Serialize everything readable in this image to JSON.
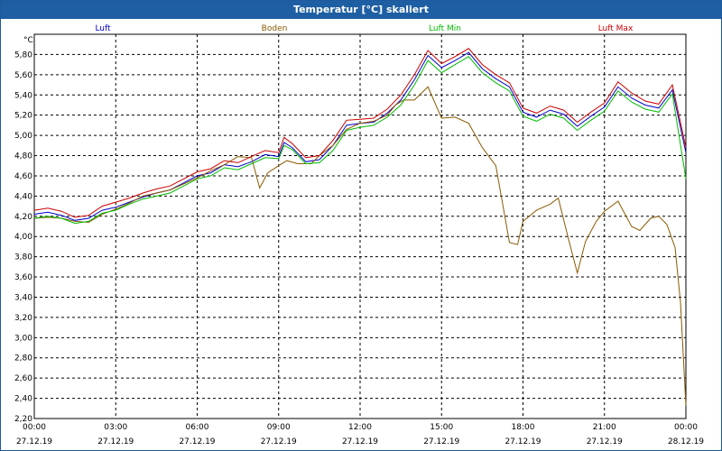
{
  "window": {
    "title": "Temperatur [°C] skaliert"
  },
  "chart_data": {
    "type": "line",
    "title": "Temperatur [°C] skaliert",
    "ylabel": "°C",
    "xlabel": "",
    "ylim": [
      2.2,
      6.0
    ],
    "yticks": [
      2.2,
      2.4,
      2.6,
      2.8,
      3.0,
      3.2,
      3.4,
      3.6,
      3.8,
      4.0,
      4.2,
      4.4,
      4.6,
      4.8,
      5.0,
      5.2,
      5.4,
      5.6,
      5.8
    ],
    "xlim": [
      0,
      24
    ],
    "xticks": [
      {
        "x": 0,
        "time": "00:00",
        "date": "27.12.19"
      },
      {
        "x": 3,
        "time": "03:00",
        "date": "27.12.19"
      },
      {
        "x": 6,
        "time": "06:00",
        "date": "27.12.19"
      },
      {
        "x": 9,
        "time": "09:00",
        "date": "27.12.19"
      },
      {
        "x": 12,
        "time": "12:00",
        "date": "27.12.19"
      },
      {
        "x": 15,
        "time": "15:00",
        "date": "27.12.19"
      },
      {
        "x": 18,
        "time": "18:00",
        "date": "27.12.19"
      },
      {
        "x": 21,
        "time": "21:00",
        "date": "27.12.19"
      },
      {
        "x": 24,
        "time": "00:00",
        "date": "28.12.19"
      }
    ],
    "grid": true,
    "legend_position": "top",
    "series": [
      {
        "name": "Luft",
        "color": "#0000cc",
        "points": [
          [
            0,
            4.22
          ],
          [
            0.5,
            4.24
          ],
          [
            1,
            4.21
          ],
          [
            1.5,
            4.16
          ],
          [
            2,
            4.18
          ],
          [
            2.5,
            4.26
          ],
          [
            3,
            4.29
          ],
          [
            3.5,
            4.34
          ],
          [
            4,
            4.39
          ],
          [
            4.5,
            4.43
          ],
          [
            5,
            4.46
          ],
          [
            5.5,
            4.53
          ],
          [
            6,
            4.6
          ],
          [
            6.5,
            4.63
          ],
          [
            7,
            4.71
          ],
          [
            7.5,
            4.69
          ],
          [
            8,
            4.74
          ],
          [
            8.5,
            4.81
          ],
          [
            9,
            4.79
          ],
          [
            9.2,
            4.93
          ],
          [
            9.5,
            4.88
          ],
          [
            10,
            4.74
          ],
          [
            10.5,
            4.76
          ],
          [
            11,
            4.9
          ],
          [
            11.5,
            5.1
          ],
          [
            12,
            5.12
          ],
          [
            12.5,
            5.13
          ],
          [
            13,
            5.22
          ],
          [
            13.5,
            5.35
          ],
          [
            14,
            5.55
          ],
          [
            14.5,
            5.79
          ],
          [
            15,
            5.67
          ],
          [
            15.5,
            5.74
          ],
          [
            16,
            5.82
          ],
          [
            16.5,
            5.66
          ],
          [
            17,
            5.56
          ],
          [
            17.5,
            5.48
          ],
          [
            18,
            5.23
          ],
          [
            18.5,
            5.18
          ],
          [
            19,
            5.25
          ],
          [
            19.5,
            5.21
          ],
          [
            20,
            5.09
          ],
          [
            20.5,
            5.19
          ],
          [
            21,
            5.28
          ],
          [
            21.5,
            5.48
          ],
          [
            22,
            5.37
          ],
          [
            22.5,
            5.3
          ],
          [
            23,
            5.27
          ],
          [
            23.5,
            5.45
          ],
          [
            24,
            4.83
          ]
        ]
      },
      {
        "name": "Boden",
        "color": "#8b5a00",
        "points": [
          [
            0,
            4.18
          ],
          [
            0.5,
            4.19
          ],
          [
            1,
            4.18
          ],
          [
            1.5,
            4.15
          ],
          [
            2,
            4.14
          ],
          [
            2.5,
            4.22
          ],
          [
            3,
            4.27
          ],
          [
            3.5,
            4.33
          ],
          [
            4,
            4.4
          ],
          [
            4.5,
            4.43
          ],
          [
            5,
            4.46
          ],
          [
            5.5,
            4.52
          ],
          [
            6,
            4.58
          ],
          [
            6.5,
            4.65
          ],
          [
            7,
            4.71
          ],
          [
            7.5,
            4.79
          ],
          [
            8,
            4.78
          ],
          [
            8.3,
            4.48
          ],
          [
            8.6,
            4.63
          ],
          [
            9,
            4.7
          ],
          [
            9.3,
            4.75
          ],
          [
            9.7,
            4.72
          ],
          [
            10.2,
            4.72
          ],
          [
            10.5,
            4.8
          ],
          [
            11,
            4.9
          ],
          [
            11.5,
            5.06
          ],
          [
            12,
            5.12
          ],
          [
            12.5,
            5.14
          ],
          [
            13,
            5.2
          ],
          [
            13.3,
            5.3
          ],
          [
            13.6,
            5.35
          ],
          [
            14,
            5.35
          ],
          [
            14.5,
            5.48
          ],
          [
            15,
            5.17
          ],
          [
            15.5,
            5.18
          ],
          [
            16,
            5.12
          ],
          [
            16.5,
            4.88
          ],
          [
            17,
            4.7
          ],
          [
            17.3,
            4.25
          ],
          [
            17.5,
            3.94
          ],
          [
            17.8,
            3.92
          ],
          [
            18,
            4.15
          ],
          [
            18.5,
            4.26
          ],
          [
            19,
            4.32
          ],
          [
            19.3,
            4.38
          ],
          [
            19.7,
            3.95
          ],
          [
            20,
            3.64
          ],
          [
            20.3,
            3.95
          ],
          [
            20.7,
            4.15
          ],
          [
            21,
            4.25
          ],
          [
            21.5,
            4.35
          ],
          [
            22,
            4.1
          ],
          [
            22.3,
            4.06
          ],
          [
            22.7,
            4.18
          ],
          [
            23,
            4.2
          ],
          [
            23.3,
            4.12
          ],
          [
            23.6,
            3.89
          ],
          [
            23.8,
            3.35
          ],
          [
            24,
            2.33
          ]
        ]
      },
      {
        "name": "Luft Min",
        "color": "#00bb00",
        "points": [
          [
            0,
            4.18
          ],
          [
            0.5,
            4.2
          ],
          [
            1,
            4.18
          ],
          [
            1.5,
            4.13
          ],
          [
            2,
            4.15
          ],
          [
            2.5,
            4.23
          ],
          [
            3,
            4.26
          ],
          [
            3.5,
            4.32
          ],
          [
            4,
            4.37
          ],
          [
            4.5,
            4.4
          ],
          [
            5,
            4.43
          ],
          [
            5.5,
            4.5
          ],
          [
            6,
            4.57
          ],
          [
            6.5,
            4.6
          ],
          [
            7,
            4.68
          ],
          [
            7.5,
            4.66
          ],
          [
            8,
            4.72
          ],
          [
            8.5,
            4.78
          ],
          [
            9,
            4.77
          ],
          [
            9.2,
            4.9
          ],
          [
            9.5,
            4.86
          ],
          [
            10,
            4.72
          ],
          [
            10.5,
            4.73
          ],
          [
            11,
            4.85
          ],
          [
            11.5,
            5.05
          ],
          [
            12,
            5.08
          ],
          [
            12.5,
            5.1
          ],
          [
            13,
            5.18
          ],
          [
            13.5,
            5.3
          ],
          [
            14,
            5.5
          ],
          [
            14.5,
            5.74
          ],
          [
            15,
            5.62
          ],
          [
            15.5,
            5.7
          ],
          [
            16,
            5.78
          ],
          [
            16.5,
            5.62
          ],
          [
            17,
            5.52
          ],
          [
            17.5,
            5.44
          ],
          [
            18,
            5.19
          ],
          [
            18.5,
            5.14
          ],
          [
            19,
            5.21
          ],
          [
            19.5,
            5.17
          ],
          [
            20,
            5.05
          ],
          [
            20.5,
            5.15
          ],
          [
            21,
            5.24
          ],
          [
            21.5,
            5.44
          ],
          [
            22,
            5.33
          ],
          [
            22.5,
            5.26
          ],
          [
            23,
            5.23
          ],
          [
            23.5,
            5.41
          ],
          [
            24,
            4.57
          ]
        ]
      },
      {
        "name": "Luft Max",
        "color": "#cc0000",
        "points": [
          [
            0,
            4.26
          ],
          [
            0.5,
            4.28
          ],
          [
            1,
            4.25
          ],
          [
            1.5,
            4.19
          ],
          [
            2,
            4.21
          ],
          [
            2.5,
            4.3
          ],
          [
            3,
            4.34
          ],
          [
            3.5,
            4.38
          ],
          [
            4,
            4.43
          ],
          [
            4.5,
            4.47
          ],
          [
            5,
            4.5
          ],
          [
            5.5,
            4.57
          ],
          [
            6,
            4.64
          ],
          [
            6.5,
            4.67
          ],
          [
            7,
            4.75
          ],
          [
            7.5,
            4.73
          ],
          [
            8,
            4.79
          ],
          [
            8.5,
            4.85
          ],
          [
            9,
            4.83
          ],
          [
            9.2,
            4.98
          ],
          [
            9.5,
            4.92
          ],
          [
            10,
            4.78
          ],
          [
            10.5,
            4.8
          ],
          [
            11,
            4.95
          ],
          [
            11.5,
            5.15
          ],
          [
            12,
            5.16
          ],
          [
            12.5,
            5.17
          ],
          [
            13,
            5.26
          ],
          [
            13.5,
            5.4
          ],
          [
            14,
            5.6
          ],
          [
            14.5,
            5.84
          ],
          [
            15,
            5.71
          ],
          [
            15.5,
            5.78
          ],
          [
            16,
            5.86
          ],
          [
            16.5,
            5.7
          ],
          [
            17,
            5.6
          ],
          [
            17.5,
            5.52
          ],
          [
            18,
            5.27
          ],
          [
            18.5,
            5.22
          ],
          [
            19,
            5.29
          ],
          [
            19.5,
            5.25
          ],
          [
            20,
            5.13
          ],
          [
            20.5,
            5.23
          ],
          [
            21,
            5.32
          ],
          [
            21.5,
            5.53
          ],
          [
            22,
            5.42
          ],
          [
            22.5,
            5.34
          ],
          [
            23,
            5.31
          ],
          [
            23.5,
            5.5
          ],
          [
            24,
            4.88
          ]
        ]
      }
    ]
  }
}
